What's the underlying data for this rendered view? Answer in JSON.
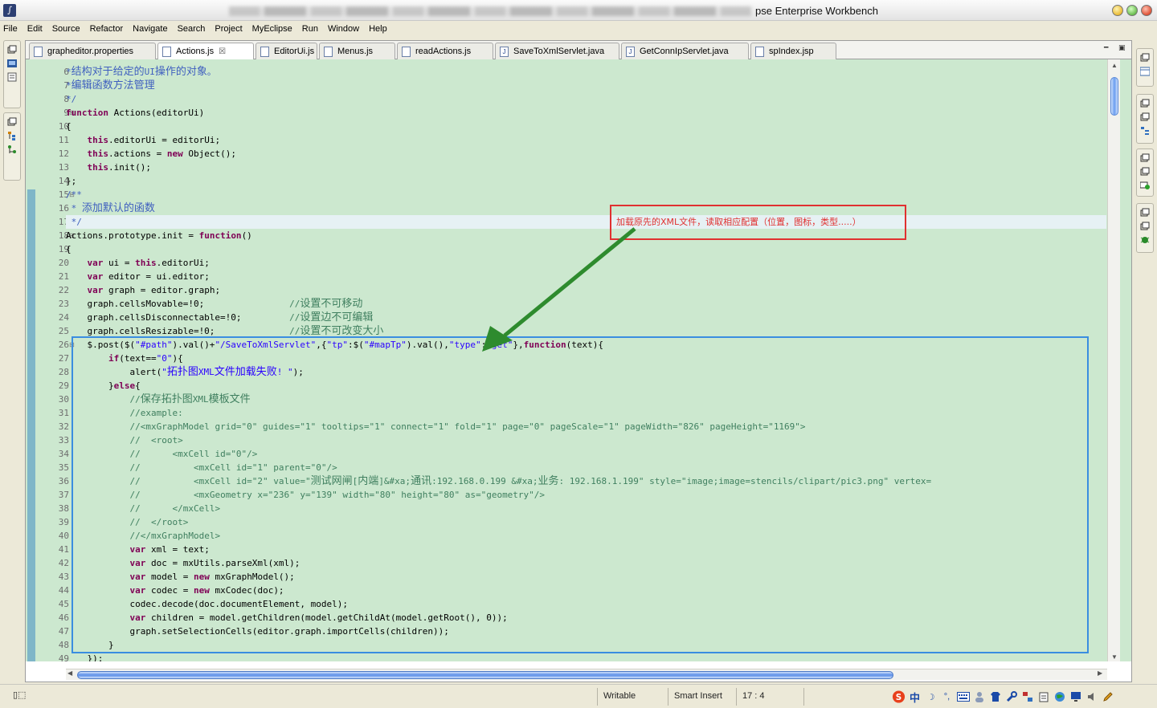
{
  "window": {
    "title": "pse Enterprise Workbench"
  },
  "menu": [
    "File",
    "Edit",
    "Source",
    "Refactor",
    "Navigate",
    "Search",
    "Project",
    "MyEclipse",
    "Run",
    "Window",
    "Help"
  ],
  "tabs": [
    {
      "label": "grapheditor.properties",
      "icon": "properties-file-icon",
      "active": false
    },
    {
      "label": "Actions.js",
      "icon": "js-file-icon",
      "active": true
    },
    {
      "label": "EditorUi.js",
      "icon": "js-file-icon",
      "active": false
    },
    {
      "label": "Menus.js",
      "icon": "js-file-icon",
      "active": false
    },
    {
      "label": "readActions.js",
      "icon": "js-file-icon",
      "active": false
    },
    {
      "label": "SaveToXmlServlet.java",
      "icon": "java-file-icon",
      "active": false
    },
    {
      "label": "GetConnIpServlet.java",
      "icon": "java-file-icon",
      "active": false
    },
    {
      "label": "spIndex.jsp",
      "icon": "jsp-file-icon",
      "active": false
    }
  ],
  "code": {
    "current_line": 17,
    "lines": [
      {
        "n": "6",
        "html": "<span class='jdoc'>*结构对于给定的UI操作的对象。</span>"
      },
      {
        "n": "7",
        "html": "<span class='jdoc'>*编辑函数方法管理</span>"
      },
      {
        "n": "8",
        "html": "<span class='jdoc'>*/</span>"
      },
      {
        "n": "9",
        "fold": true,
        "html": "<span class='kw'>function</span> Actions(editorUi)"
      },
      {
        "n": "10",
        "html": "{"
      },
      {
        "n": "11",
        "html": "    <span class='kw'>this</span>.editorUi = editorUi;"
      },
      {
        "n": "12",
        "html": "    <span class='kw'>this</span>.actions = <span class='kw'>new</span> Object();"
      },
      {
        "n": "13",
        "html": "    <span class='kw'>this</span>.init();"
      },
      {
        "n": "14",
        "html": "};"
      },
      {
        "n": "15",
        "fold": true,
        "html": "<span class='jdoc'>/**</span>"
      },
      {
        "n": "16",
        "html": "<span class='jdoc'> * 添加默认的函数</span>"
      },
      {
        "n": "17",
        "html": "<span class='jdoc'> */</span>"
      },
      {
        "n": "18",
        "fold": true,
        "html": "Actions.prototype.init = <span class='kw'>function</span>()"
      },
      {
        "n": "19",
        "html": "{"
      },
      {
        "n": "20",
        "html": "    <span class='kw'>var</span> ui = <span class='kw'>this</span>.editorUi;"
      },
      {
        "n": "21",
        "html": "    <span class='kw'>var</span> editor = ui.editor;"
      },
      {
        "n": "22",
        "html": "    <span class='kw'>var</span> graph = editor.graph;"
      },
      {
        "n": "23",
        "html": "    graph.cellsMovable=!0;                <span class='cmt'>//设置不可移动</span>"
      },
      {
        "n": "24",
        "html": "    graph.cellsDisconnectable=!0;         <span class='cmt'>//设置边不可编辑</span>"
      },
      {
        "n": "25",
        "html": "    graph.cellsResizable=!0;              <span class='cmt'>//设置不可改变大小</span>"
      },
      {
        "n": "26",
        "fold": true,
        "html": "    $.post($(<span class='str'>\"#path\"</span>).val()+<span class='str'>\"/SaveToXmlServlet\"</span>,{<span class='str'>\"tp\"</span>:$(<span class='str'>\"#mapTp\"</span>).val(),<span class='str'>\"type\"</span>:<span class='str'>\"get\"</span>},<span class='kw'>function</span>(text){"
      },
      {
        "n": "27",
        "html": "        <span class='kw'>if</span>(text==<span class='str'>\"0\"</span>){"
      },
      {
        "n": "28",
        "html": "            alert(<span class='str'>\"拓扑图XML文件加载失败! \"</span>);"
      },
      {
        "n": "29",
        "html": "        }<span class='kw'>else</span>{"
      },
      {
        "n": "30",
        "html": "            <span class='cmt'>//保存拓扑图XML模板文件</span>"
      },
      {
        "n": "31",
        "html": "            <span class='cmt'>//example:</span>"
      },
      {
        "n": "32",
        "html": "            <span class='cmt'>//&lt;mxGraphModel grid=\"0\" guides=\"1\" tooltips=\"1\" connect=\"1\" fold=\"1\" page=\"0\" pageScale=\"1\" pageWidth=\"826\" pageHeight=\"1169\"&gt;</span>"
      },
      {
        "n": "33",
        "html": "            <span class='cmt'>//  &lt;root&gt;</span>"
      },
      {
        "n": "34",
        "html": "            <span class='cmt'>//      &lt;mxCell id=\"0\"/&gt;</span>"
      },
      {
        "n": "35",
        "html": "            <span class='cmt'>//          &lt;mxCell id=\"1\" parent=\"0\"/&gt;</span>"
      },
      {
        "n": "36",
        "html": "            <span class='cmt'>//          &lt;mxCell id=\"2\" value=\"测试网闸[内端]&amp;#xa;通讯:192.168.0.199 &amp;#xa;业务: 192.168.1.199\" style=\"image;image=stencils/clipart/pic3.png\" vertex=</span>"
      },
      {
        "n": "37",
        "html": "            <span class='cmt'>//          &lt;mxGeometry x=\"236\" y=\"139\" width=\"80\" height=\"80\" as=\"geometry\"/&gt;</span>"
      },
      {
        "n": "38",
        "html": "            <span class='cmt'>//      &lt;/mxCell&gt;</span>"
      },
      {
        "n": "39",
        "html": "            <span class='cmt'>//  &lt;/root&gt;</span>"
      },
      {
        "n": "40",
        "html": "            <span class='cmt'>//&lt;/mxGraphModel&gt;</span>"
      },
      {
        "n": "41",
        "html": "            <span class='kw'>var</span> xml = text;"
      },
      {
        "n": "42",
        "html": "            <span class='kw'>var</span> doc = mxUtils.parseXml(xml);"
      },
      {
        "n": "43",
        "html": "            <span class='kw'>var</span> model = <span class='kw'>new</span> mxGraphModel();"
      },
      {
        "n": "44",
        "html": "            <span class='kw'>var</span> codec = <span class='kw'>new</span> mxCodec(doc);"
      },
      {
        "n": "45",
        "html": "            codec.decode(doc.documentElement, model);"
      },
      {
        "n": "46",
        "html": "            <span class='kw'>var</span> children = model.getChildren(model.getChildAt(model.getRoot(), 0));"
      },
      {
        "n": "47",
        "html": "            graph.setSelectionCells(editor.graph.importCells(children));"
      },
      {
        "n": "48",
        "html": "        }"
      },
      {
        "n": "49",
        "html": "    });"
      }
    ]
  },
  "annotation": {
    "note": "加载原先的XML文件，读取相应配置（位置，图标，类型.....）",
    "color_red": "#e03030",
    "color_blue": "#3a8de0",
    "color_arrow": "#2e8b2e"
  },
  "status": {
    "writable": "Writable",
    "insert_mode": "Smart Insert",
    "position": "17 : 4"
  },
  "tray": {
    "ime_label": "中"
  },
  "colors": {
    "editor_bg": "#cce8cf",
    "current_line_bg": "#e6f1f4",
    "keyword": "#7f0055",
    "string": "#2a00ff",
    "comment": "#3f7f5f",
    "javadoc": "#3f5fbf"
  }
}
